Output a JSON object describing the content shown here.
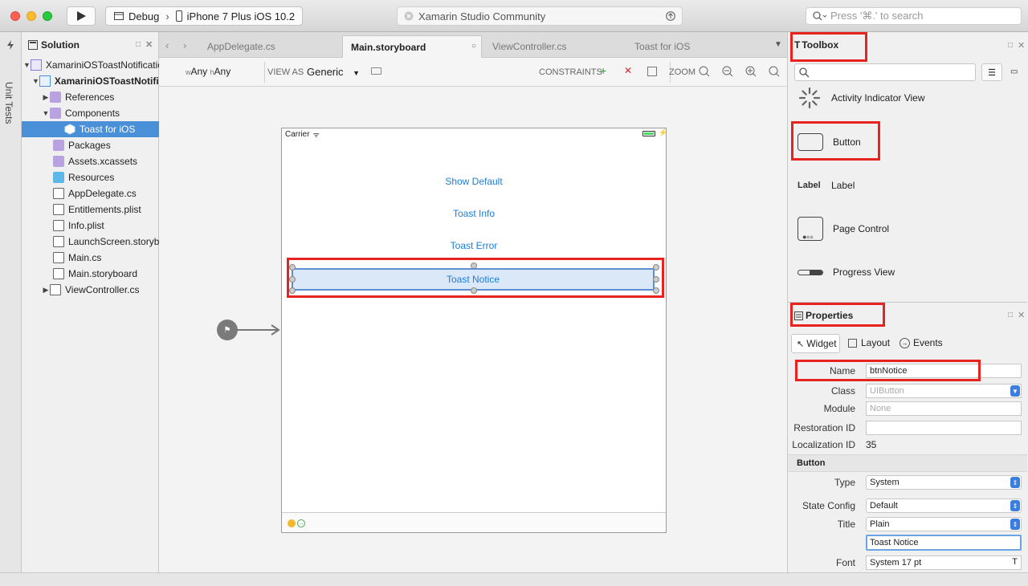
{
  "toolbar": {
    "config": "Debug",
    "separator": "›",
    "device": "iPhone 7 Plus iOS 10.2",
    "status": "Xamarin Studio Community",
    "search_placeholder": "Press '⌘.' to search"
  },
  "left_strip": {
    "label": "Unit Tests"
  },
  "solution": {
    "title": "Solution",
    "items": [
      {
        "label": "XamariniOSToastNotificatio",
        "icon": "solution-icon"
      },
      {
        "label": "XamariniOSToastNotific",
        "icon": "project-icon"
      },
      {
        "label": "References",
        "icon": "folder-icon"
      },
      {
        "label": "Components",
        "icon": "folder-icon"
      },
      {
        "label": "Toast for iOS",
        "icon": "component-icon"
      },
      {
        "label": "Packages",
        "icon": "folder-icon"
      },
      {
        "label": "Assets.xcassets",
        "icon": "assets-icon"
      },
      {
        "label": "Resources",
        "icon": "folder-icon"
      },
      {
        "label": "AppDelegate.cs",
        "icon": "file-icon"
      },
      {
        "label": "Entitlements.plist",
        "icon": "file-icon"
      },
      {
        "label": "Info.plist",
        "icon": "file-icon"
      },
      {
        "label": "LaunchScreen.storyboard",
        "icon": "file-icon"
      },
      {
        "label": "Main.cs",
        "icon": "file-icon"
      },
      {
        "label": "Main.storyboard",
        "icon": "file-icon"
      },
      {
        "label": "ViewController.cs",
        "icon": "file-icon"
      }
    ]
  },
  "tabs": [
    {
      "label": "AppDelegate.cs"
    },
    {
      "label": "Main.storyboard"
    },
    {
      "label": "ViewController.cs"
    },
    {
      "label": "Toast for iOS"
    }
  ],
  "designer": {
    "size_w": "w",
    "size_any1": "Any",
    "size_h": "h",
    "size_any2": "Any",
    "view_as_label": "VIEW AS",
    "view_as_value": "Generic",
    "constraints_label": "CONSTRAINTS",
    "zoom_label": "ZOOM"
  },
  "phone": {
    "carrier": "Carrier",
    "buttons": [
      "Show Default",
      "Toast Info",
      "Toast Error",
      "Toast Notice"
    ]
  },
  "toolbox": {
    "title": "Toolbox",
    "items": [
      {
        "label": "Activity Indicator View",
        "icon": "activity-indicator-icon"
      },
      {
        "label": "Button",
        "icon": "button-icon"
      },
      {
        "label": "Label",
        "icon": "label-icon",
        "icon_text": "Label"
      },
      {
        "label": "Page Control",
        "icon": "page-control-icon"
      },
      {
        "label": "Progress View",
        "icon": "progress-view-icon"
      }
    ]
  },
  "properties": {
    "title": "Properties",
    "tabs": [
      "Widget",
      "Layout",
      "Events"
    ],
    "name_label": "Name",
    "name_value": "btnNotice",
    "class_label": "Class",
    "class_value": "UIButton",
    "module_label": "Module",
    "module_placeholder": "None",
    "restoration_label": "Restoration ID",
    "localization_label": "Localization ID",
    "localization_value": "35",
    "section_button": "Button",
    "type_label": "Type",
    "type_value": "System",
    "state_label": "State Config",
    "state_value": "Default",
    "title_label": "Title",
    "title_value": "Plain",
    "title_text": "Toast Notice",
    "font_label": "Font",
    "font_value": "System 17 pt"
  },
  "colors": {
    "highlight": "#e8231f",
    "selection": "#4a90d9",
    "link": "#1b7ed8"
  }
}
